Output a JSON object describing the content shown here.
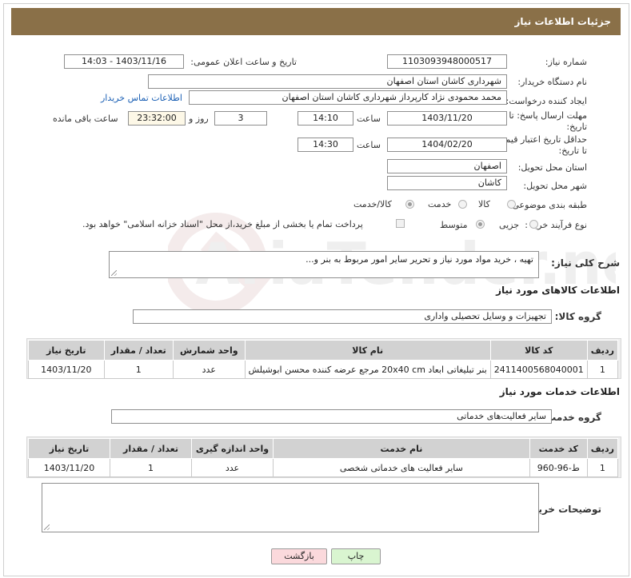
{
  "header": {
    "title": "جزئیات اطلاعات نیاز"
  },
  "fields": {
    "need_number_label": "شماره نیاز:",
    "need_number": "1103093948000517",
    "announce_label": "تاریخ و ساعت اعلان عمومی:",
    "announce_value": "1403/11/16 - 14:03",
    "buyer_org_label": "نام دستگاه خریدار:",
    "buyer_org": "شهرداری کاشان استان اصفهان",
    "creator_label": "ایجاد کننده درخواست:",
    "creator": "محمد محمودی نژاد کارپرداز شهرداری کاشان استان اصفهان",
    "contact_link": "اطلاعات تماس خریدار",
    "deadline_label": "مهلت ارسال پاسخ: تا تاریخ:",
    "deadline_date": "1403/11/20",
    "time_label": "ساعت",
    "deadline_time": "14:10",
    "days_value": "3",
    "days_label": "روز و",
    "remaining_time": "23:32:00",
    "remaining_label": "ساعت باقی مانده",
    "validity_label": "حداقل تاریخ اعتبار قیمت: تا تاریخ:",
    "validity_date": "1404/02/20",
    "validity_time": "14:30",
    "province_label": "استان محل تحویل:",
    "province": "اصفهان",
    "city_label": "شهر محل تحویل:",
    "city": "کاشان",
    "category_label": "طبقه بندی موضوعی:",
    "category_options": [
      "کالا",
      "خدمت",
      "کالا/خدمت"
    ],
    "category_selected": 2,
    "process_label": "نوع فرآیند خرید :",
    "process_options": [
      "جزیی",
      "متوسط"
    ],
    "process_selected": 1,
    "payment_text": "پرداخت تمام یا بخشی از مبلغ خرید،از محل \"اسناد خزانه اسلامی\" خواهد بود.",
    "description_label": "شرح کلی نیاز:",
    "description": "تهیه ، خرید مواد مورد نیاز و تحریر سایر امور مربوط به بنر و..."
  },
  "goods": {
    "section_title": "اطلاعات کالاهای مورد نیاز",
    "group_label": "گروه کالا:",
    "group_value": "تجهیزات و وسایل تحصیلی واداری",
    "headers": [
      "ردیف",
      "کد کالا",
      "نام کالا",
      "واحد شمارش",
      "تعداد / مقدار",
      "تاریخ نیاز"
    ],
    "rows": [
      [
        "1",
        "2411400568040001",
        "بنر تبلیغاتی ابعاد 20x40 cm مرجع عرضه کننده محسن ابوشیلش",
        "عدد",
        "1",
        "1403/11/20"
      ]
    ]
  },
  "services": {
    "section_title": "اطلاعات خدمات مورد نیاز",
    "group_label": "گروه خدمت:",
    "group_value": "سایر فعالیت‌های خدماتی",
    "headers": [
      "ردیف",
      "کد خدمت",
      "نام خدمت",
      "واحد اندازه گیری",
      "تعداد / مقدار",
      "تاریخ نیاز"
    ],
    "rows": [
      [
        "1",
        "ط-96-960",
        "سایر فعالیت های خدماتی شخصی",
        "عدد",
        "1",
        "1403/11/20"
      ]
    ]
  },
  "buyer_notes_label": "توضیحات خریدار:",
  "buttons": {
    "print": "چاپ",
    "back": "بازگشت"
  },
  "colors": {
    "header_bg": "#8a7048",
    "print_btn": "#d9f5d0",
    "back_btn": "#fbd9dc"
  }
}
